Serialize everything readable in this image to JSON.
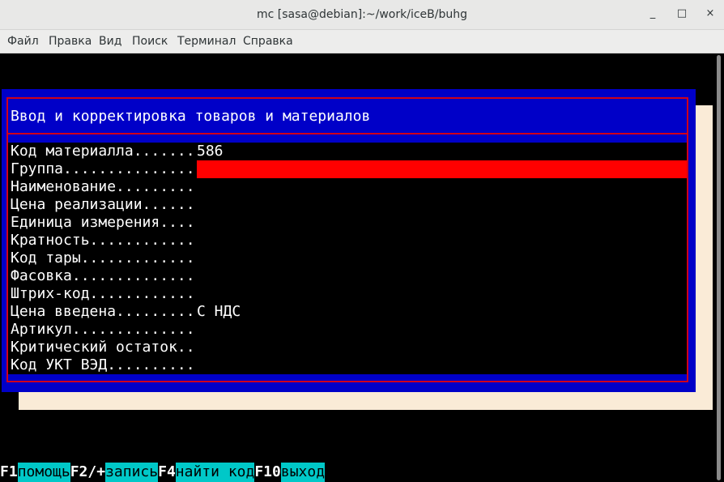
{
  "window": {
    "title": "mc [sasa@debian]:~/work/iceB/buhg",
    "minimize_glyph": "_",
    "maximize_glyph": "□",
    "close_glyph": "×"
  },
  "menu": [
    "Файл",
    "Правка",
    "Вид",
    "Поиск",
    "Терминал",
    "Справка"
  ],
  "dialog": {
    "title": "Ввод и корректировка товаров и материалов",
    "fields": [
      {
        "label": "Код материалла.......",
        "value": "586"
      },
      {
        "label": "Группа...............",
        "value": ""
      },
      {
        "label": "Наименование.........",
        "value": ""
      },
      {
        "label": "Цена реализации......",
        "value": ""
      },
      {
        "label": "Единица измерения....",
        "value": ""
      },
      {
        "label": "Кратность............",
        "value": ""
      },
      {
        "label": "Код тары.............",
        "value": ""
      },
      {
        "label": "Фасовка..............",
        "value": ""
      },
      {
        "label": "Штрих-код............",
        "value": ""
      },
      {
        "label": "Цена введена.........",
        "value": "С НДС"
      },
      {
        "label": "Артикул..............",
        "value": ""
      },
      {
        "label": "Критический остаток..",
        "value": ""
      },
      {
        "label": "Код УКТ ВЭД..........",
        "value": ""
      }
    ],
    "active_field_index": 1
  },
  "fkeys": [
    {
      "key": "F1",
      "label": "помощь"
    },
    {
      "key": "F2/+",
      "label": "запись"
    },
    {
      "key": "F4",
      "label": "найти код"
    },
    {
      "key": "F10",
      "label": "выход"
    }
  ],
  "colors": {
    "dialog_bg": "#0000c8",
    "dialog_border": "#d0021b",
    "active_field": "#ff0000",
    "fkey_label_bg": "#00c8c8",
    "shadow": "#faebd7"
  }
}
